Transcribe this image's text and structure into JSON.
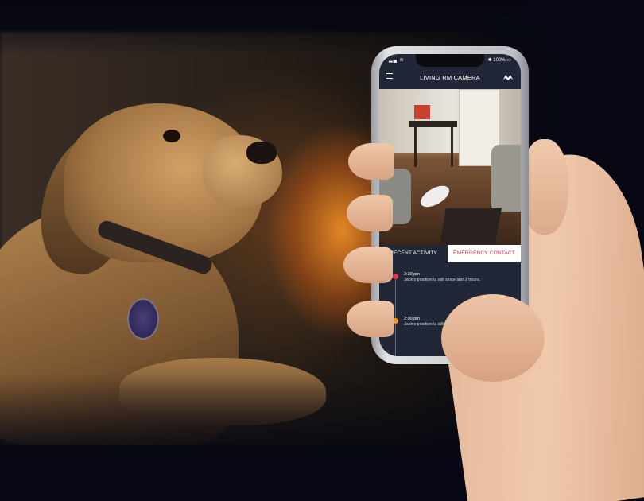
{
  "status_bar": {
    "battery": "100%"
  },
  "header": {
    "title": "LIVING RM CAMERA"
  },
  "tabs": [
    {
      "label": "RECENT ACTIVITY"
    },
    {
      "label": "EMERGENCY CONTACT"
    }
  ],
  "activity": [
    {
      "time": "2:30 pm",
      "text": "Jack's position is still since last 2 hours."
    },
    {
      "time": "2:00 pm",
      "text": "Jack's position is still since last 2 hours."
    }
  ],
  "colors": {
    "accent": "#e0354a",
    "secondary": "#f39a1e",
    "app_bg": "#222737"
  },
  "icons": [
    "menu-icon",
    "brand-logo-icon",
    "wifi-icon",
    "bluetooth-icon",
    "battery-icon"
  ]
}
